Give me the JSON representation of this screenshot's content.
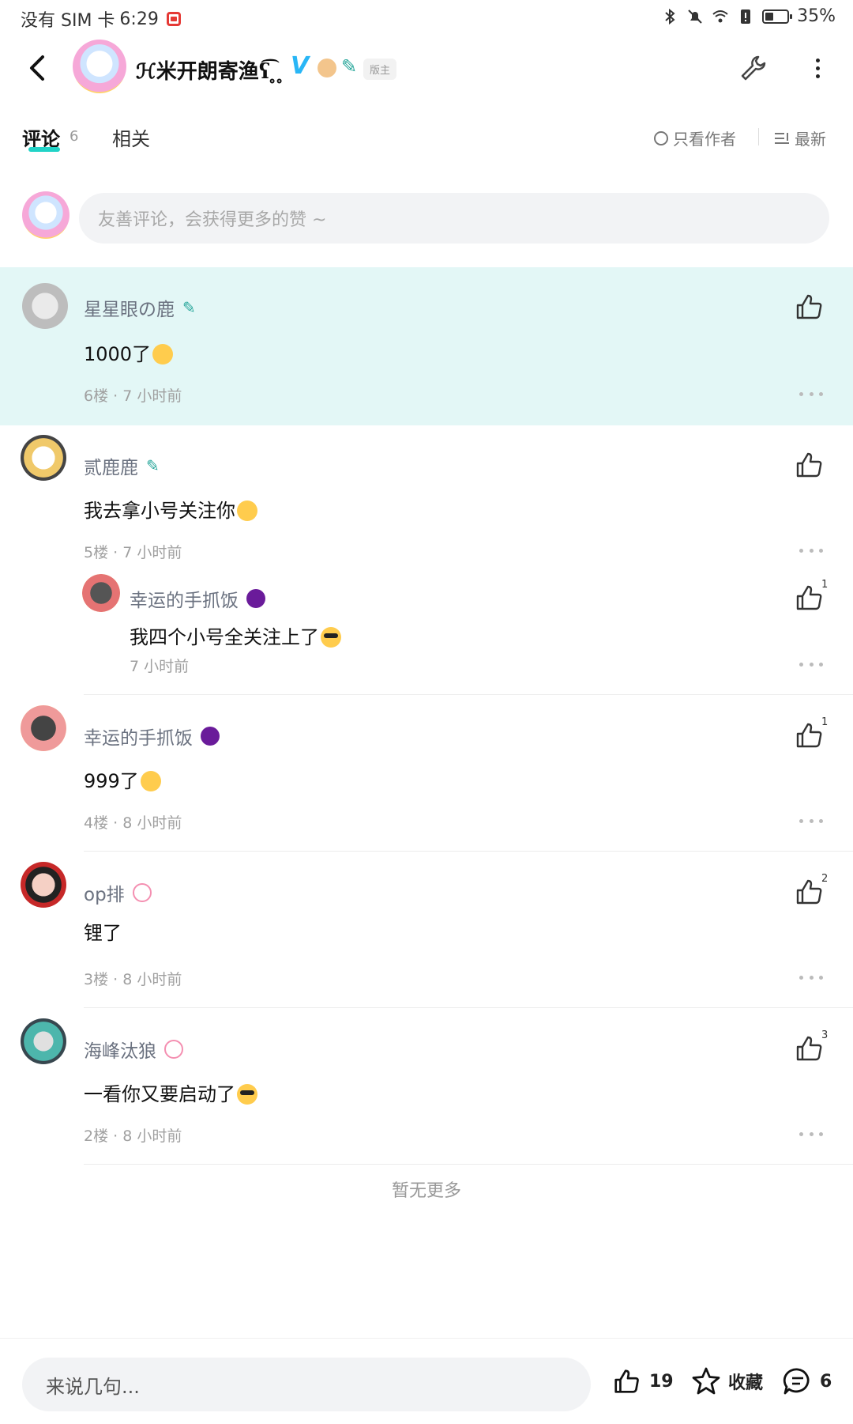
{
  "status_bar": {
    "carrier": "没有 SIM 卡",
    "time": "6:29",
    "battery": "35%"
  },
  "header": {
    "title": "ℋ米开朗寄渔ʕ͡ ̥ ̥",
    "mod_badge": "版主"
  },
  "tabs": {
    "comments_label": "评论",
    "comments_count": "6",
    "related_label": "相关",
    "author_only": "只看作者",
    "sort_label": "最新"
  },
  "comment_input": {
    "placeholder": "友善评论，会获得更多的赞 ~"
  },
  "comments": [
    {
      "name": "星星眼の鹿",
      "text": "1000了",
      "meta": "6楼 · 7 小时前",
      "likes": ""
    },
    {
      "name": "贰鹿鹿",
      "text": "我去拿小号关注你",
      "meta": "5楼 · 7 小时前",
      "likes": "",
      "reply": {
        "name": "幸运的手抓饭",
        "text": "我四个小号全关注上了",
        "meta": "7 小时前",
        "likes": "1"
      }
    },
    {
      "name": "幸运的手抓饭",
      "text": "999了",
      "meta": "4楼 · 8 小时前",
      "likes": "1"
    },
    {
      "name": "op排",
      "text": "锂了",
      "meta": "3楼 · 8 小时前",
      "likes": "2"
    },
    {
      "name": "海峰汰狼",
      "text": "一看你又要启动了",
      "meta": "2楼 · 8 小时前",
      "likes": "3"
    }
  ],
  "no_more": "暂无更多",
  "bottom_bar": {
    "input_placeholder": "来说几句...",
    "likes": "19",
    "favorite_label": "收藏",
    "comments": "6"
  },
  "colors": {
    "accent": "#21d3c7",
    "highlight_bg": "#e3f7f6"
  }
}
